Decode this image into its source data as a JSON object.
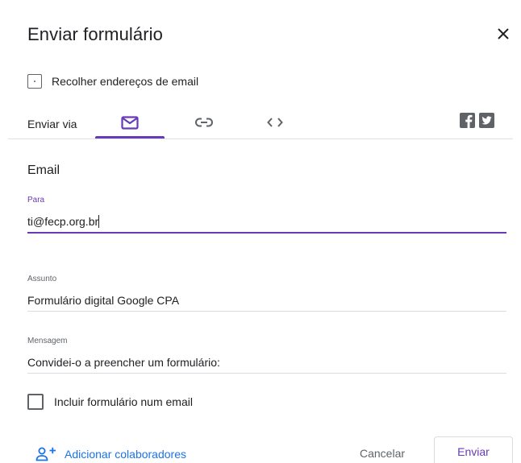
{
  "dialog": {
    "title": "Enviar formulário"
  },
  "collect_emails": {
    "label": "Recolher endereços de email",
    "checked": false
  },
  "send_via": {
    "label": "Enviar via",
    "tabs": [
      {
        "name": "email",
        "icon": "mail-icon",
        "selected": true
      },
      {
        "name": "link",
        "icon": "link-icon",
        "selected": false
      },
      {
        "name": "embed",
        "icon": "code-icon",
        "selected": false
      }
    ],
    "social": [
      "facebook-icon",
      "twitter-icon"
    ]
  },
  "email_section": {
    "title": "Email",
    "to": {
      "label": "Para",
      "value": "ti@fecp.org.br"
    },
    "subject": {
      "label": "Assunto",
      "value": "Formulário digital Google CPA"
    },
    "message": {
      "label": "Mensagem",
      "value": "Convidei-o a preencher um formulário:"
    }
  },
  "include_form": {
    "label": "Incluir formulário num email",
    "checked": false
  },
  "footer": {
    "add_collaborators": "Adicionar colaboradores",
    "cancel": "Cancelar",
    "send": "Enviar"
  },
  "colors": {
    "accent": "#673ab7",
    "link": "#1a73e8",
    "icon": "#5f6368"
  }
}
